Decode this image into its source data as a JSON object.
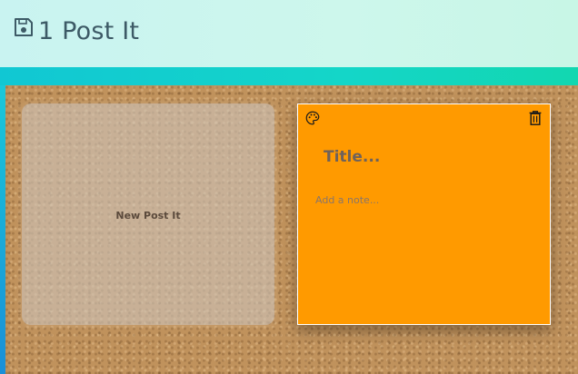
{
  "header": {
    "icon": "floppy-disk-icon",
    "title": "1 Post It",
    "title_color": "#3d5a66"
  },
  "board": {
    "new_postit_label": "New Post It"
  },
  "postits": [
    {
      "color": "#ff9a00",
      "palette_icon": "palette-icon",
      "delete_icon": "trash-icon",
      "title_placeholder": "Title...",
      "title_value": "",
      "note_placeholder": "Add a note...",
      "note_value": ""
    }
  ]
}
